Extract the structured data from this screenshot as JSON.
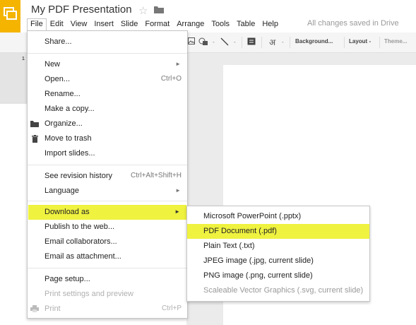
{
  "header": {
    "doc_title": "My PDF Presentation",
    "save_status": "All changes saved in Drive",
    "app_icon": "slides-logo-icon",
    "star_icon": "star-icon",
    "folder_icon": "folder-icon"
  },
  "menubar": {
    "items": [
      "File",
      "Edit",
      "View",
      "Insert",
      "Slide",
      "Format",
      "Arrange",
      "Tools",
      "Table",
      "Help"
    ],
    "open_item": "File"
  },
  "toolbar": {
    "background_label": "Background...",
    "layout_label": "Layout -",
    "theme_label": "Theme..."
  },
  "filmstrip": {
    "slide_number": "1"
  },
  "file_menu": {
    "share": "Share...",
    "new": "New",
    "open": "Open...",
    "open_shortcut": "Ctrl+O",
    "rename": "Rename...",
    "make_copy": "Make a copy...",
    "organize": "Organize...",
    "move_to_trash": "Move to trash",
    "import_slides": "Import slides...",
    "revision_history": "See revision history",
    "revision_shortcut": "Ctrl+Alt+Shift+H",
    "language": "Language",
    "download_as": "Download as",
    "publish": "Publish to the web...",
    "email_collaborators": "Email collaborators...",
    "email_attachment": "Email as attachment...",
    "page_setup": "Page setup...",
    "print_settings": "Print settings and preview",
    "print": "Print",
    "print_shortcut": "Ctrl+P"
  },
  "download_submenu": {
    "pptx": "Microsoft PowerPoint (.pptx)",
    "pdf": "PDF Document (.pdf)",
    "txt": "Plain Text (.txt)",
    "jpg": "JPEG image (.jpg, current slide)",
    "png": "PNG image (.png, current slide)",
    "svg": "Scaleable Vector Graphics (.svg, current slide)"
  },
  "colors": {
    "brand": "#f4b400",
    "highlight": "#eff23f"
  }
}
